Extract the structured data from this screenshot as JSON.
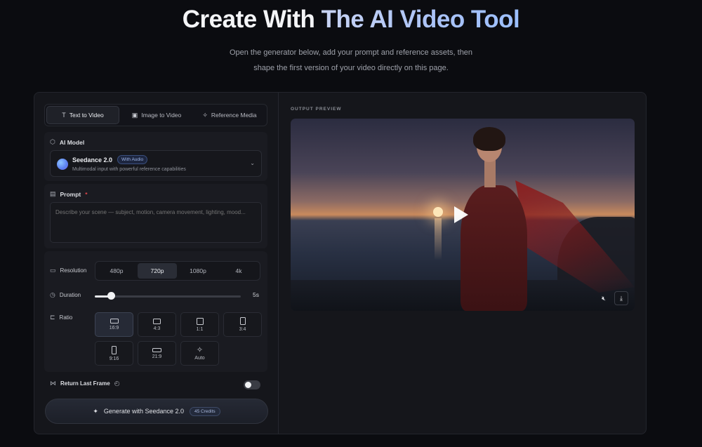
{
  "hero": {
    "title_plain": "Create With ",
    "title_accent": "The AI Video Tool",
    "subtitle_line1": "Open the generator below, add your prompt and reference assets, then",
    "subtitle_line2": "shape the first version of your video directly on this page."
  },
  "tabs": [
    {
      "label": "Text to Video",
      "icon": "T",
      "active": true
    },
    {
      "label": "Image to Video",
      "icon": "▣",
      "active": false
    },
    {
      "label": "Reference Media",
      "icon": "✧",
      "active": false
    }
  ],
  "model": {
    "section_label": "AI Model",
    "name": "Seedance 2.0",
    "badge": "With Audio",
    "description": "Multimodal input with powerful reference capabilities"
  },
  "prompt": {
    "label": "Prompt",
    "required_mark": "*",
    "placeholder": "Describe your scene — subject, motion, camera movement, lighting, mood..."
  },
  "settings": {
    "resolution_label": "Resolution",
    "resolution_options": [
      "480p",
      "720p",
      "1080p",
      "4k"
    ],
    "resolution_selected": "720p",
    "duration_label": "Duration",
    "duration_value": "5s",
    "duration_level": 0.11,
    "ratio_label": "Ratio",
    "ratios": [
      {
        "label": "16:9",
        "active": true
      },
      {
        "label": "4:3",
        "active": false
      },
      {
        "label": "1:1",
        "active": false
      },
      {
        "label": "3:4",
        "active": false
      },
      {
        "label": "9:16",
        "active": false
      },
      {
        "label": "21:9",
        "active": false
      },
      {
        "label": "Auto",
        "active": false
      }
    ]
  },
  "last_frame": {
    "label": "Return Last Frame",
    "enabled": false
  },
  "generate": {
    "label": "Generate with Seedance 2.0",
    "credits": "45 Credits"
  },
  "preview": {
    "label": "OUTPUT PREVIEW"
  }
}
